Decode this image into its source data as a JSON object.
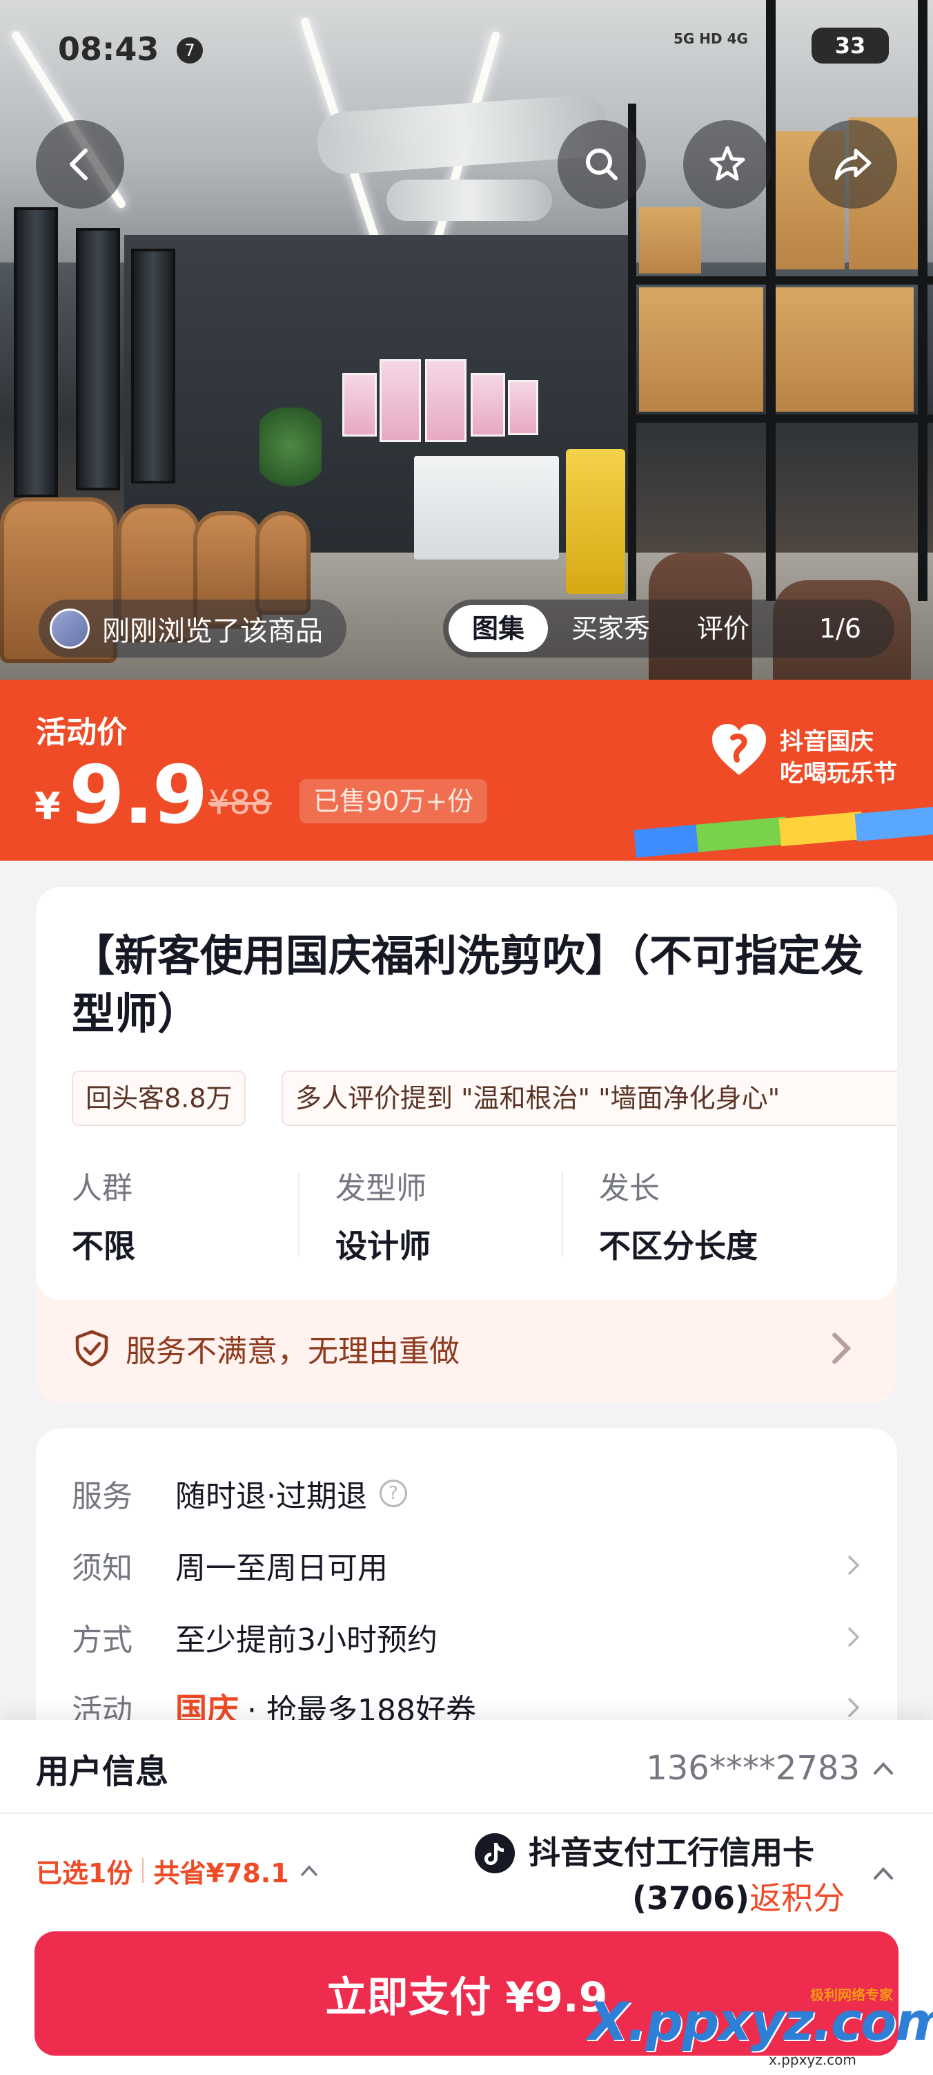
{
  "status_bar": {
    "time": "08:43",
    "notif_count": "7",
    "network": "5G HD 4G",
    "battery": "33"
  },
  "hero": {
    "viewed_text": "刚刚浏览了该商品",
    "tabs": [
      "图集",
      "买家秀",
      "评价"
    ],
    "active_tab": "图集",
    "counter": "1/6"
  },
  "price": {
    "activity_label": "活动价",
    "currency": "¥",
    "current": "9.9",
    "original": "¥88",
    "sold": "已售90万+份",
    "festival_line1": "抖音国庆",
    "festival_line2": "吃喝玩乐节"
  },
  "product": {
    "title": "【新客使用国庆福利洗剪吹】（不可指定发型师）",
    "tags": [
      "回头客8.8万",
      "多人评价提到 \"温和根治\" \"墙面净化身心\""
    ],
    "attrs": [
      {
        "key": "人群",
        "value": "不限"
      },
      {
        "key": "发型师",
        "value": "设计师"
      },
      {
        "key": "发长",
        "value": "不区分长度"
      }
    ],
    "guarantee": "服务不满意，无理由重做"
  },
  "info": {
    "rows": [
      {
        "key": "服务",
        "value": "随时退·过期退"
      },
      {
        "key": "须知",
        "value": "周一至周日可用"
      },
      {
        "key": "方式",
        "value": "至少提前3小时预约"
      },
      {
        "key": "活动",
        "badge": "国庆",
        "value": "· 抢最多188好券"
      }
    ]
  },
  "checkout": {
    "user_label": "用户信息",
    "user_phone": "136****2783",
    "selected": "已选1份",
    "saved": "共省¥78.1",
    "pay_method_line1": "抖音支付工行信用卡",
    "pay_method_card": "(3706)",
    "pay_method_reward": "返积分",
    "pay_button": "立即支付 ¥9.9"
  },
  "watermark": {
    "main": "X.ppxyz.com",
    "top": "极利网络专家",
    "small": "x.ppxyz.com"
  },
  "colors": {
    "accent_red": "#ee4b26",
    "pay_button": "#ee2c4d",
    "text_primary": "#161823",
    "text_secondary": "#747680"
  }
}
